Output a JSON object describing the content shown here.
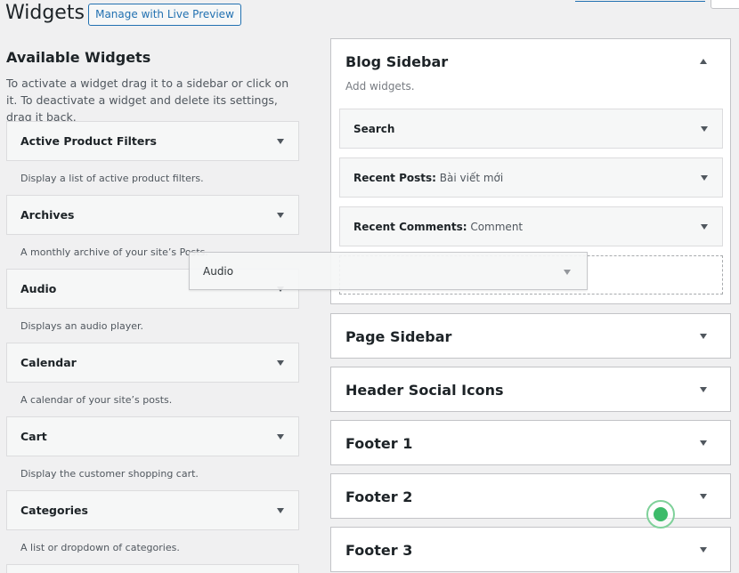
{
  "header": {
    "title": "Widgets",
    "live_preview_button": "Manage with Live Preview"
  },
  "available": {
    "heading": "Available Widgets",
    "description": "To activate a widget drag it to a sidebar or click on it. To deactivate a widget and delete its settings, drag it back.",
    "widgets": [
      {
        "label": "Active Product Filters",
        "desc": "Display a list of active product filters."
      },
      {
        "label": "Archives",
        "desc": "A monthly archive of your site’s Posts."
      },
      {
        "label": "Audio",
        "desc": "Displays an audio player."
      },
      {
        "label": "Calendar",
        "desc": "A calendar of your site’s posts."
      },
      {
        "label": "Cart",
        "desc": "Display the customer shopping cart."
      },
      {
        "label": "Categories",
        "desc": "A list or dropdown of categories."
      }
    ]
  },
  "sidebars": {
    "blog": {
      "title": "Blog Sidebar",
      "add_widgets": "Add widgets.",
      "widgets": [
        {
          "label": "Search",
          "sub": ""
        },
        {
          "label": "Recent Posts:",
          "sub": " Bài viết mới"
        },
        {
          "label": "Recent Comments:",
          "sub": " Comment"
        }
      ]
    },
    "others": [
      {
        "title": "Page Sidebar"
      },
      {
        "title": "Header Social Icons"
      },
      {
        "title": "Footer 1"
      },
      {
        "title": "Footer 2"
      },
      {
        "title": "Footer 3"
      }
    ]
  },
  "dragging_widget": {
    "label": "Audio"
  }
}
